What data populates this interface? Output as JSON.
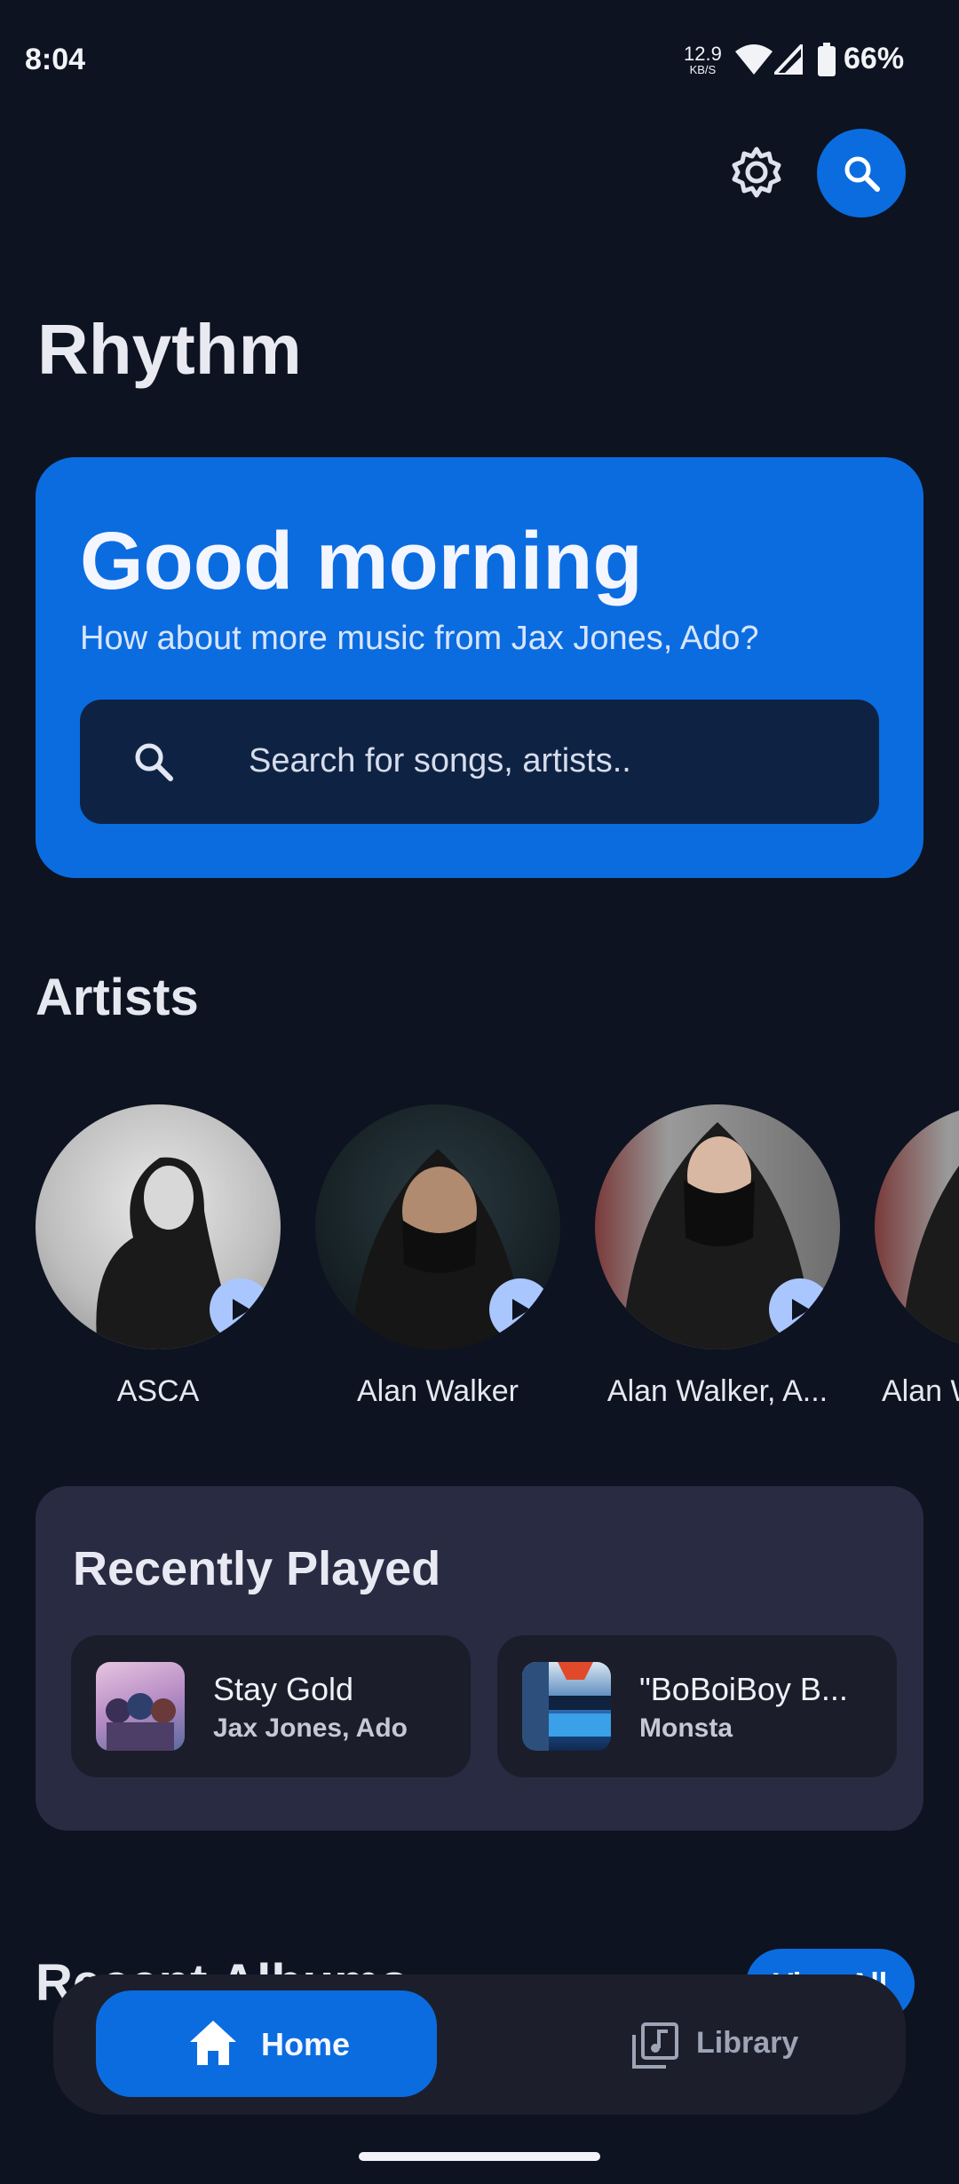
{
  "status_bar": {
    "time": "8:04",
    "net_speed": "12.9",
    "net_unit": "KB/S",
    "battery": "66%"
  },
  "app": {
    "title": "Rhythm"
  },
  "hero": {
    "greeting": "Good morning",
    "subtitle": "How about more music from Jax Jones, Ado?",
    "search_placeholder": "Search for songs, artists.."
  },
  "artists": {
    "title": "Artists",
    "items": [
      {
        "name": "ASCA"
      },
      {
        "name": "Alan Walker"
      },
      {
        "name": "Alan Walker, A..."
      },
      {
        "name": "Alan W"
      }
    ]
  },
  "recently_played": {
    "title": "Recently Played",
    "items": [
      {
        "title": "Stay Gold",
        "artist": "Jax Jones, Ado"
      },
      {
        "title": "\"BoBoiBoy B...",
        "artist": "Monsta"
      }
    ]
  },
  "recent_albums": {
    "title": "Recent Albums",
    "view_all": "View All"
  },
  "nav": {
    "home": "Home",
    "library": "Library"
  },
  "colors": {
    "accent": "#0b6ce0",
    "background": "#0d1320",
    "card": "#292b42"
  }
}
